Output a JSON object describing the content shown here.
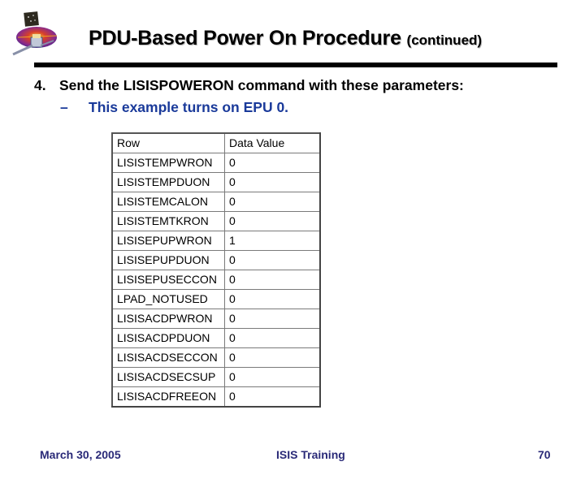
{
  "slide": {
    "logo_icon": "isis-satellite-logo-icon",
    "title": "PDU-Based Power On Procedure",
    "title_suffix": "(continued)",
    "step_number": "4.",
    "step_text": "Send the LISISPOWERON command with these parameters:",
    "sub_bullet_dash": "–",
    "sub_bullet_text": "This example turns on EPU 0.",
    "colors": {
      "title": "#000000",
      "sub_bullet": "#1a3a9a",
      "footer": "#2a2a78",
      "rule": "#000000"
    }
  },
  "table": {
    "headers": [
      "Row",
      "Data Value"
    ],
    "rows": [
      [
        "LISISTEMPWRON",
        "0"
      ],
      [
        "LISISTEMPDUON",
        "0"
      ],
      [
        "LISISTEMCALON",
        "0"
      ],
      [
        "LISISTEMTKRON",
        "0"
      ],
      [
        "LISISEPUPWRON",
        "1"
      ],
      [
        "LISISEPUPDUON",
        "0"
      ],
      [
        "LISISEPUSECCON",
        "0"
      ],
      [
        "LPAD_NOTUSED",
        "0"
      ],
      [
        "LISISACDPWRON",
        "0"
      ],
      [
        "LISISACDPDUON",
        "0"
      ],
      [
        "LISISACDSECCON",
        "0"
      ],
      [
        "LISISACDSECSUP",
        "0"
      ],
      [
        "LISISACDFREEON",
        "0"
      ]
    ]
  },
  "footer": {
    "date": "March 30, 2005",
    "center": "ISIS Training",
    "page_number": "70"
  }
}
